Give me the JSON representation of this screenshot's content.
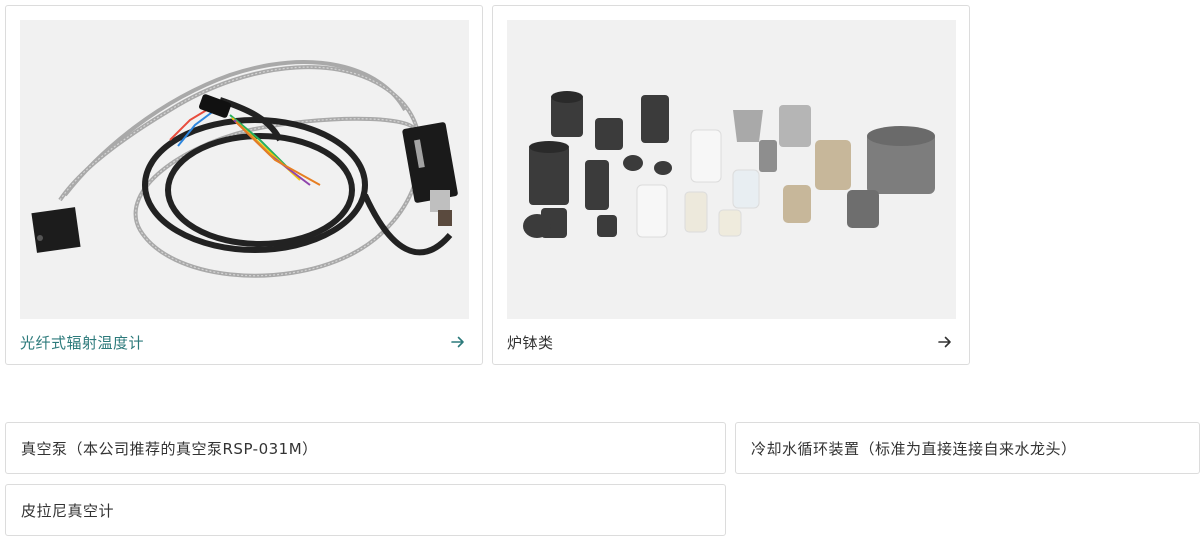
{
  "cards": [
    {
      "title": "光纤式辐射温度计",
      "title_color": "#2c7a7b",
      "arrow_color": "#2c7a7b"
    },
    {
      "title": "炉钵类",
      "title_color": "#333333",
      "arrow_color": "#333333"
    }
  ],
  "links": [
    {
      "label": "真空泵（本公司推荐的真空泵RSP-031M）"
    },
    {
      "label": "冷却水循环装置（标准为直接连接自来水龙头）"
    },
    {
      "label": "皮拉尼真空计"
    }
  ],
  "icons": {
    "card_arrow": "arrow-right-icon"
  }
}
